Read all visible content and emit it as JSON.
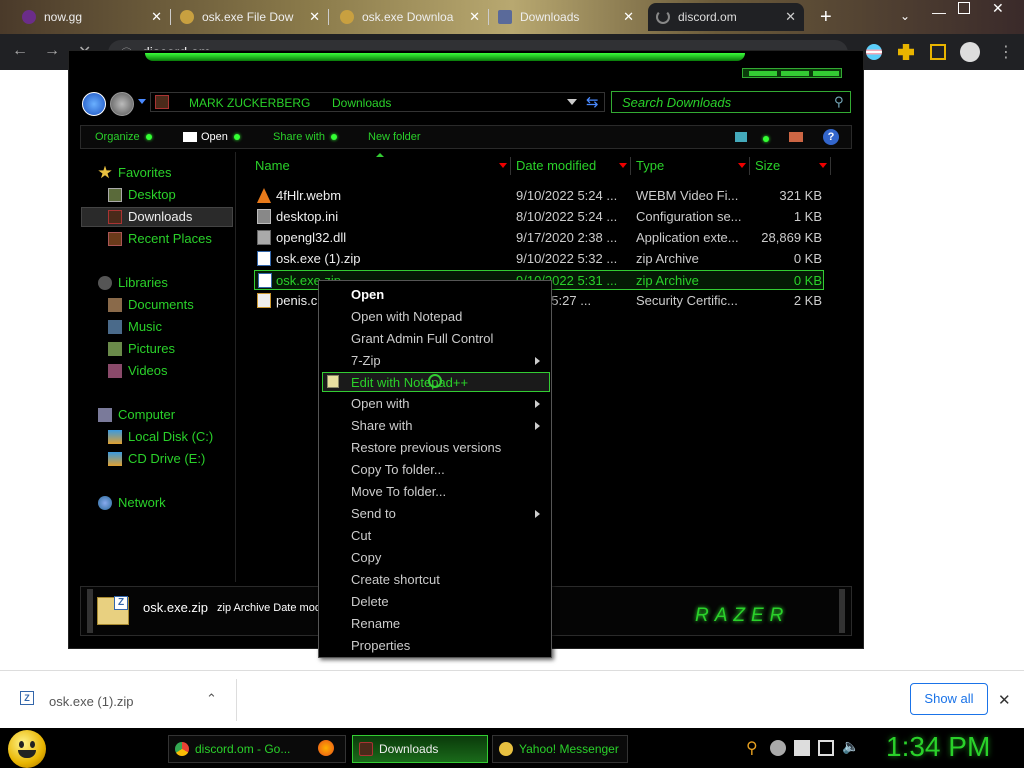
{
  "browser": {
    "tabs": [
      {
        "title": "now.gg",
        "active": false
      },
      {
        "title": "osk.exe File Dow",
        "active": false
      },
      {
        "title": "osk.exe Downloa",
        "active": false
      },
      {
        "title": "Downloads",
        "active": false
      },
      {
        "title": "discord.om",
        "active": true
      }
    ],
    "new_tab_glyph": "+",
    "address": "discord.om"
  },
  "explorer": {
    "breadcrumb": [
      "MARK ZUCKERBERG",
      "Downloads"
    ],
    "search_placeholder": "Search Downloads",
    "commands": {
      "organize": "Organize",
      "open": "Open",
      "share": "Share with",
      "new_folder": "New folder"
    },
    "nav": {
      "favorites": "Favorites",
      "desktop": "Desktop",
      "downloads": "Downloads",
      "recent": "Recent Places",
      "libraries": "Libraries",
      "documents": "Documents",
      "music": "Music",
      "pictures": "Pictures",
      "videos": "Videos",
      "computer": "Computer",
      "local_disk": "Local Disk (C:)",
      "cd_drive": "CD Drive (E:)",
      "network": "Network"
    },
    "columns": {
      "name": "Name",
      "date": "Date modified",
      "type": "Type",
      "size": "Size"
    },
    "files": [
      {
        "name": "4fHlr.webm",
        "date": "9/10/2022 5:24 ...",
        "type": "WEBM Video Fi...",
        "size": "321 KB"
      },
      {
        "name": "desktop.ini",
        "date": "8/10/2022 5:24 ...",
        "type": "Configuration se...",
        "size": "1 KB"
      },
      {
        "name": "opengl32.dll",
        "date": "9/17/2020 2:38 ...",
        "type": "Application exte...",
        "size": "28,869 KB"
      },
      {
        "name": "osk.exe (1).zip",
        "date": "9/10/2022 5:32 ...",
        "type": "zip Archive",
        "size": "0 KB"
      },
      {
        "name": "osk.exe.zip",
        "date": "9/10/2022 5:31 ...",
        "type": "zip Archive",
        "size": "0 KB"
      },
      {
        "name": "penis.c",
        "date": "022 5:27 ...",
        "type": "Security Certific...",
        "size": "2 KB"
      }
    ],
    "details": {
      "name": "osk.exe.zip",
      "info": "zip Archive Date mod"
    },
    "brand": "RAZER"
  },
  "context_menu": {
    "items": [
      {
        "label": "Open",
        "bold": true,
        "submenu": false
      },
      {
        "label": "Open with Notepad",
        "bold": false,
        "submenu": false
      },
      {
        "label": "Grant Admin Full Control",
        "bold": false,
        "submenu": false
      },
      {
        "label": "7-Zip",
        "bold": false,
        "submenu": true
      },
      {
        "label": "Edit with Notepad++",
        "bold": false,
        "submenu": false,
        "highlighted": true
      },
      {
        "label": "Open with",
        "bold": false,
        "submenu": true
      },
      {
        "label": "Share with",
        "bold": false,
        "submenu": true
      },
      {
        "label": "Restore previous versions",
        "bold": false,
        "submenu": false
      },
      {
        "label": "Copy To folder...",
        "bold": false,
        "submenu": false
      },
      {
        "label": "Move To folder...",
        "bold": false,
        "submenu": false
      },
      {
        "label": "Send to",
        "bold": false,
        "submenu": true
      },
      {
        "label": "Cut",
        "bold": false,
        "submenu": false
      },
      {
        "label": "Copy",
        "bold": false,
        "submenu": false
      },
      {
        "label": "Create shortcut",
        "bold": false,
        "submenu": false
      },
      {
        "label": "Delete",
        "bold": false,
        "submenu": false
      },
      {
        "label": "Rename",
        "bold": false,
        "submenu": false
      },
      {
        "label": "Properties",
        "bold": false,
        "submenu": false
      }
    ]
  },
  "download_bar": {
    "file": "osk.exe (1).zip",
    "show_all": "Show all",
    "close_glyph": "✕"
  },
  "taskbar": {
    "items": [
      {
        "label": "discord.om - Go..."
      },
      {
        "label": "Downloads"
      },
      {
        "label": "Yahoo! Messenger"
      }
    ],
    "clock": "1:34 PM"
  },
  "colors": {
    "accent_green": "#2ad12a",
    "chrome_dark": "#202124",
    "link_blue": "#1a73e8"
  }
}
